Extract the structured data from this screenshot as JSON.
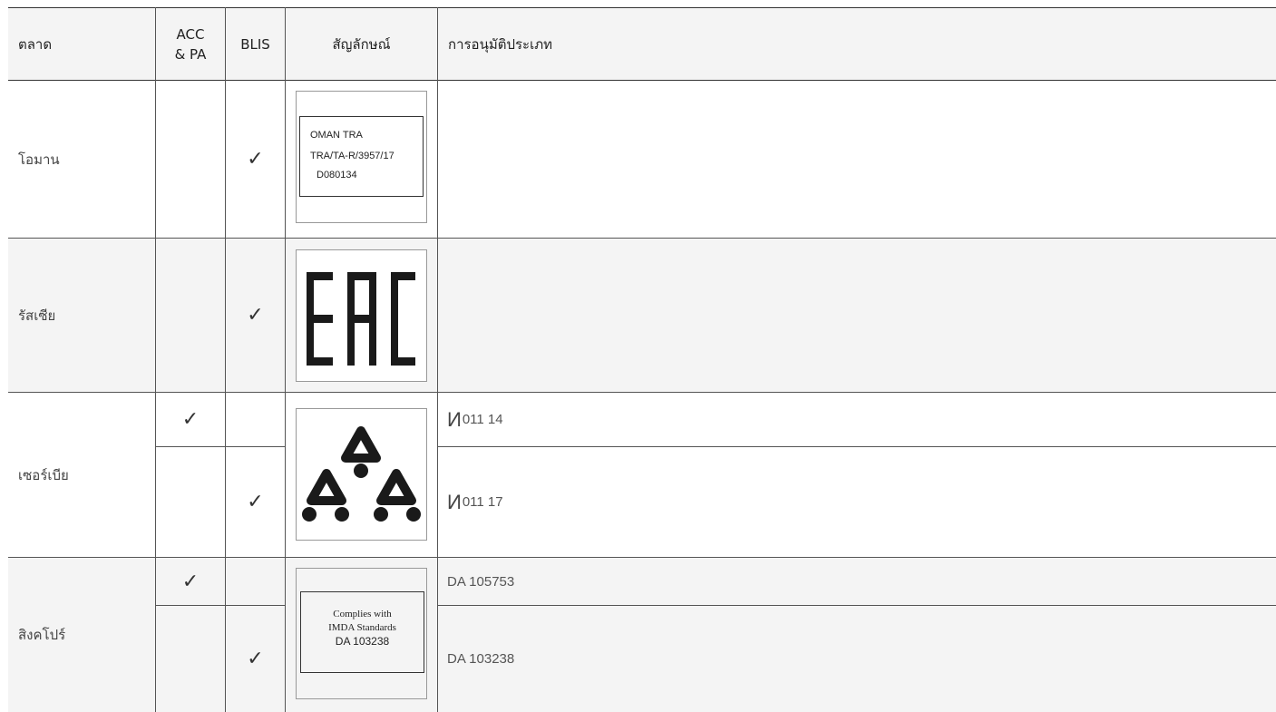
{
  "header": {
    "market": "ตลาด",
    "acc_pa": "ACC & PA",
    "blis": "BLIS",
    "symbol": "สัญลักษณ์",
    "approval": "การอนุมัติประเภท"
  },
  "rows": [
    {
      "country": "โอมาน",
      "blis": "✓",
      "logo": {
        "type": "oman-tra",
        "lines": [
          "OMAN TRA",
          "TRA/TA-R/3957/17",
          "D080134"
        ]
      }
    },
    {
      "country": "รัสเซีย",
      "blis": "✓",
      "logo": {
        "type": "eac",
        "text": "EAC"
      }
    },
    {
      "country": "เซอร์เบีย",
      "logo": {
        "type": "serbia-triangles"
      },
      "sub": [
        {
          "acc_pa": "✓",
          "approval_prefix": "И",
          "approval": "011 14"
        },
        {
          "blis": "✓",
          "approval_prefix": "И",
          "approval": "011 17"
        }
      ]
    },
    {
      "country": "สิงคโปร์",
      "logo": {
        "type": "imda",
        "lines": [
          "Complies with",
          "IMDA Standards",
          "DA 103238"
        ]
      },
      "sub": [
        {
          "acc_pa": "✓",
          "approval": "DA 105753"
        },
        {
          "blis": "✓",
          "approval": "DA 103238"
        }
      ]
    }
  ]
}
